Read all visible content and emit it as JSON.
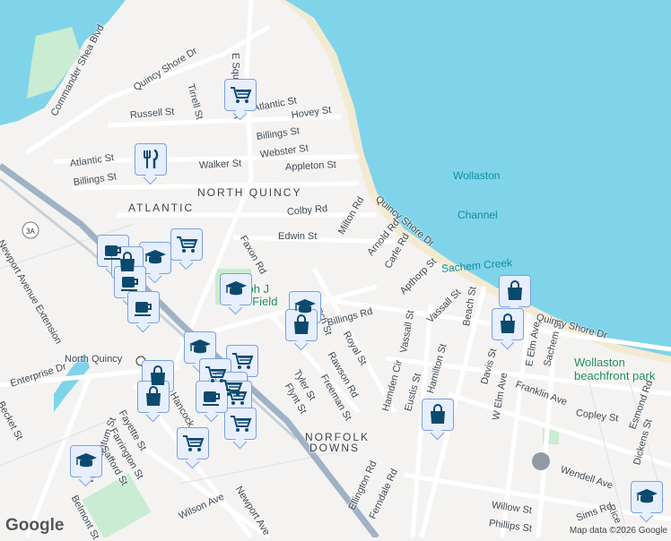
{
  "map": {
    "areas": [
      "NORTH QUINCY",
      "ATLANTIC",
      "NORFOLK",
      "DOWNS"
    ],
    "water_labels": [
      "Wollaston",
      "Channel",
      "Sachem Creek"
    ],
    "parks": [
      "Wollaston",
      "beachfront park",
      "Joseph J",
      "Koch Field"
    ],
    "places": [
      "North Quincy"
    ],
    "streets": [
      "Commander Shea Blvd",
      "Quincy Shore Dr",
      "E Squantum St",
      "Tirrell St",
      "Russell St",
      "Atlantic St",
      "Hovey St",
      "Billings St",
      "Webster St",
      "Walker St",
      "Appleton St",
      "Atlantic St",
      "Billings St",
      "Colby Rd",
      "Milton Rd",
      "Edwin St",
      "Faxon Rd",
      "Quincy Shore Dr",
      "Arnold Rd",
      "Carle Rd",
      "Apthorp St",
      "Vassall St",
      "Beach St",
      "French St",
      "Billings Rd",
      "Royal St",
      "Rawson Rd",
      "Freeman St",
      "Tyler St",
      "Flynt St",
      "Vassall St",
      "Hamden Cir",
      "Eustis St",
      "Hamilton St",
      "Davis St",
      "W Elm Ave",
      "E Elm Ave",
      "Sachem St",
      "Franklin Ave",
      "Copley St",
      "Wendell Ave",
      "Dickens St",
      "Rice Rd",
      "Sims Rd",
      "Willow St",
      "Phillips St",
      "Ellington Rd",
      "Ferndale Rd",
      "Newport Avenue Extension",
      "Enterprise Dr",
      "W Squantum St",
      "Fayette St",
      "Farrington St",
      "Safford St",
      "Becket St",
      "Belmont St",
      "Wilson Ave",
      "Newport Ave",
      "Quincy Shore Dr",
      "Esmond Rd",
      "Hancock St"
    ],
    "route_shield": "3A"
  },
  "markers": [
    {
      "type": "cart",
      "label": "Grocery"
    },
    {
      "type": "restaurant",
      "label": "Restaurant"
    },
    {
      "type": "cart",
      "label": "Grocery"
    },
    {
      "type": "cafe",
      "label": "Cafe"
    },
    {
      "type": "school",
      "label": "School"
    },
    {
      "type": "bag",
      "label": "Shop"
    },
    {
      "type": "cafe",
      "label": "Cafe"
    },
    {
      "type": "cafe",
      "label": "Cafe"
    },
    {
      "type": "school",
      "label": "School"
    },
    {
      "type": "school",
      "label": "School"
    },
    {
      "type": "bag",
      "label": "Shop"
    },
    {
      "type": "school",
      "label": "School"
    },
    {
      "type": "bag",
      "label": "Shop"
    },
    {
      "type": "bag",
      "label": "Shop"
    },
    {
      "type": "cart",
      "label": "Grocery"
    },
    {
      "type": "cart",
      "label": "Grocery"
    },
    {
      "type": "cart",
      "label": "Grocery"
    },
    {
      "type": "cart",
      "label": "Grocery"
    },
    {
      "type": "cart",
      "label": "Grocery"
    },
    {
      "type": "cart",
      "label": "Grocery"
    },
    {
      "type": "school",
      "label": "School"
    },
    {
      "type": "bag",
      "label": "Shop"
    },
    {
      "type": "bag",
      "label": "Shop"
    },
    {
      "type": "bag",
      "label": "Shop"
    },
    {
      "type": "school",
      "label": "School"
    },
    {
      "type": "cafe",
      "label": "Cafe"
    }
  ],
  "footer": {
    "logo": "Google",
    "attribution": "Map data ©2026 Google"
  },
  "colors": {
    "water": "#7fd4ea",
    "land": "#f4f3f1",
    "highway": "#9fb2c6",
    "marker_icon": "#0b4a6e",
    "park": "#c9ecd2"
  }
}
